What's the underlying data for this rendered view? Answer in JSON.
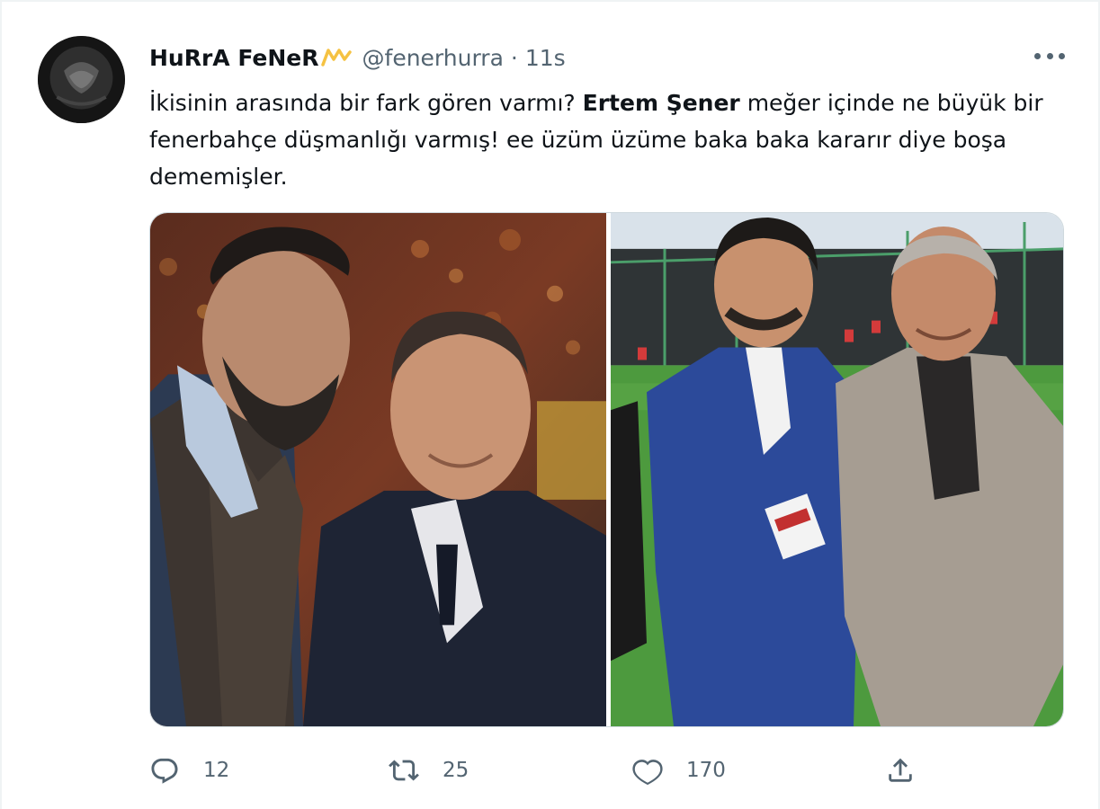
{
  "tweet": {
    "author": {
      "display_name": "HuRrA FeNeR",
      "handle": "@fenerhurra",
      "badge_icon": "crown-badge-icon",
      "badge_color": "#f5c242"
    },
    "separator": "·",
    "time": "11s",
    "text": {
      "part1": "İkisinin arasında bir fark gören varmı? ",
      "bold": "Ertem Şener",
      "part2": " meğer içinde ne büyük bir fenerbahçe düşmanlığı varmış! ee üzüm üzüme baka baka kararır diye boşa dememişler."
    },
    "media": {
      "images": [
        {
          "icon": "photo-two-men-stadium"
        },
        {
          "icon": "photo-two-men-field"
        }
      ]
    },
    "actions": {
      "reply": {
        "icon": "reply-icon",
        "count": "12"
      },
      "retweet": {
        "icon": "retweet-icon",
        "count": "25"
      },
      "like": {
        "icon": "heart-icon",
        "count": "170"
      },
      "share": {
        "icon": "share-icon"
      }
    },
    "more_icon": "more-options-icon"
  },
  "colors": {
    "text_primary": "#0f1419",
    "text_secondary": "#536471",
    "border": "#cfd9de"
  }
}
